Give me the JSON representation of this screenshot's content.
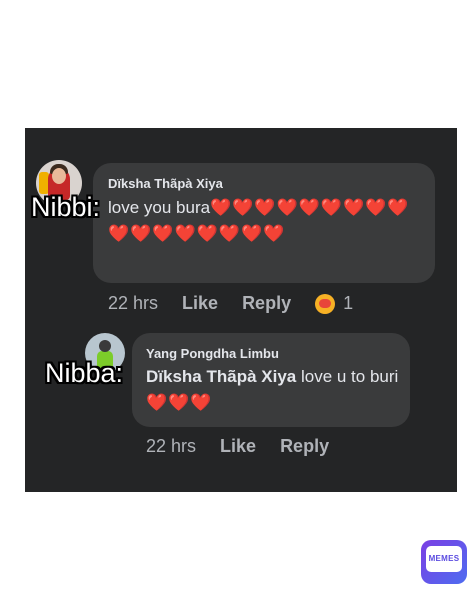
{
  "comment1": {
    "author": "Dïksha Thãpà Xiya",
    "text": "love you bura",
    "hearts": "❤️❤️❤️❤️❤️❤️❤️❤️❤️❤️❤️❤️❤️❤️❤️❤️❤️",
    "time": "22 hrs",
    "like_label": "Like",
    "reply_label": "Reply",
    "reaction_icon": "care-emoji-icon",
    "reaction_count": "1"
  },
  "comment2": {
    "author": "Yang Pongdha Limbu",
    "mention": "Dïksha Thãpà Xiya",
    "text": " love u to buri ",
    "hearts": "❤️❤️❤️",
    "time": "22 hrs",
    "like_label": "Like",
    "reply_label": "Reply"
  },
  "labels": {
    "top": "Nibbi:",
    "bottom": "Nibba:"
  },
  "logo": {
    "text": "MEMES"
  },
  "colors": {
    "panel": "#242526",
    "bubble": "#3a3b3c",
    "text": "#e4e6eb",
    "meta": "#b0b3b8",
    "heart": "#e81c2e"
  }
}
